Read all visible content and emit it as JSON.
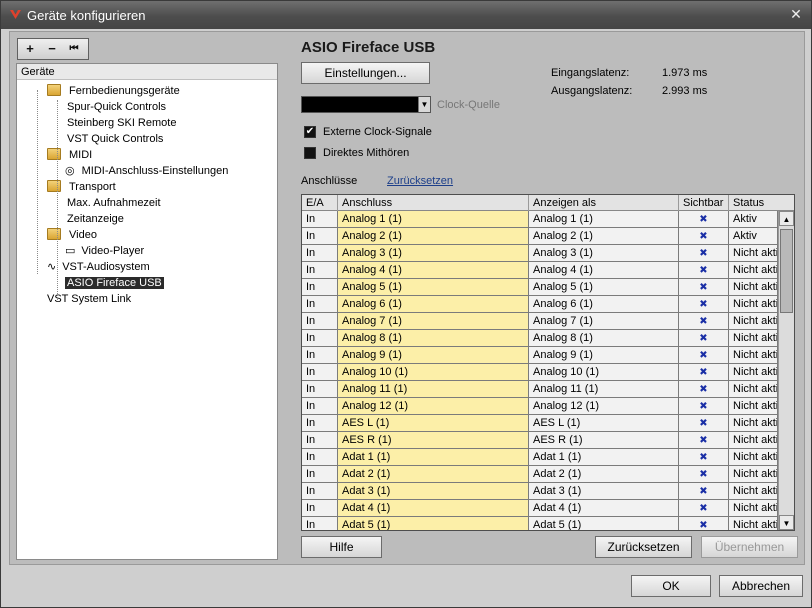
{
  "window": {
    "title": "Geräte konfigurieren",
    "close_glyph": "✕"
  },
  "toolbar": {
    "add_glyph": "+",
    "remove_glyph": "−",
    "reset_glyph": "⏮"
  },
  "tree": {
    "header": "Geräte",
    "items": [
      {
        "label": "Fernbedienungsgeräte",
        "icon": "folder"
      },
      {
        "label": "Spur-Quick Controls"
      },
      {
        "label": "Steinberg SKI Remote"
      },
      {
        "label": "VST Quick Controls"
      },
      {
        "label": "MIDI",
        "icon": "folder"
      },
      {
        "label": "MIDI-Anschluss-Einstellungen",
        "icon": "midi-port"
      },
      {
        "label": "Transport",
        "icon": "folder"
      },
      {
        "label": "Max. Aufnahmezeit"
      },
      {
        "label": "Zeitanzeige"
      },
      {
        "label": "Video",
        "icon": "folder"
      },
      {
        "label": "Video-Player",
        "icon": "video"
      },
      {
        "label": "VST-Audiosystem",
        "icon": "audio-wave"
      },
      {
        "label": "ASIO Fireface USB",
        "selected": true
      },
      {
        "label": "VST System Link"
      }
    ]
  },
  "device": {
    "title": "ASIO Fireface USB",
    "settings_button": "Einstellungen...",
    "input_latency_label": "Eingangslatenz:",
    "input_latency_value": "1.973 ms",
    "output_latency_label": "Ausgangslatenz:",
    "output_latency_value": "2.993 ms",
    "clock_source_label": "Clock-Quelle",
    "external_clock_label": "Externe Clock-Signale",
    "external_clock_checked": true,
    "direct_monitor_label": "Direktes Mithören",
    "direct_monitor_checked": false,
    "ports_label": "Anschlüsse",
    "reset_link": "Zurücksetzen"
  },
  "table": {
    "columns": [
      "E/A",
      "Anschluss",
      "Anzeigen als",
      "Sichtbar",
      "Status"
    ],
    "visible_glyph": "✖",
    "rows": [
      [
        "In",
        "Analog 1 (1)",
        "Analog 1 (1)",
        "Aktiv"
      ],
      [
        "In",
        "Analog 2 (1)",
        "Analog 2 (1)",
        "Aktiv"
      ],
      [
        "In",
        "Analog 3 (1)",
        "Analog 3 (1)",
        "Nicht aktiv"
      ],
      [
        "In",
        "Analog 4 (1)",
        "Analog 4 (1)",
        "Nicht aktiv"
      ],
      [
        "In",
        "Analog 5 (1)",
        "Analog 5 (1)",
        "Nicht aktiv"
      ],
      [
        "In",
        "Analog 6 (1)",
        "Analog 6 (1)",
        "Nicht aktiv"
      ],
      [
        "In",
        "Analog 7 (1)",
        "Analog 7 (1)",
        "Nicht aktiv"
      ],
      [
        "In",
        "Analog 8 (1)",
        "Analog 8 (1)",
        "Nicht aktiv"
      ],
      [
        "In",
        "Analog 9 (1)",
        "Analog 9 (1)",
        "Nicht aktiv"
      ],
      [
        "In",
        "Analog 10 (1)",
        "Analog 10 (1)",
        "Nicht aktiv"
      ],
      [
        "In",
        "Analog 11 (1)",
        "Analog 11 (1)",
        "Nicht aktiv"
      ],
      [
        "In",
        "Analog 12 (1)",
        "Analog 12 (1)",
        "Nicht aktiv"
      ],
      [
        "In",
        "AES L (1)",
        "AES L (1)",
        "Nicht aktiv"
      ],
      [
        "In",
        "AES R (1)",
        "AES R (1)",
        "Nicht aktiv"
      ],
      [
        "In",
        "Adat 1 (1)",
        "Adat 1 (1)",
        "Nicht aktiv"
      ],
      [
        "In",
        "Adat 2 (1)",
        "Adat 2 (1)",
        "Nicht aktiv"
      ],
      [
        "In",
        "Adat 3 (1)",
        "Adat 3 (1)",
        "Nicht aktiv"
      ],
      [
        "In",
        "Adat 4 (1)",
        "Adat 4 (1)",
        "Nicht aktiv"
      ],
      [
        "In",
        "Adat 5 (1)",
        "Adat 5 (1)",
        "Nicht aktiv"
      ]
    ]
  },
  "buttons": {
    "help": "Hilfe",
    "reset": "Zurücksetzen",
    "apply": "Übernehmen",
    "ok": "OK",
    "cancel": "Abbrechen"
  }
}
